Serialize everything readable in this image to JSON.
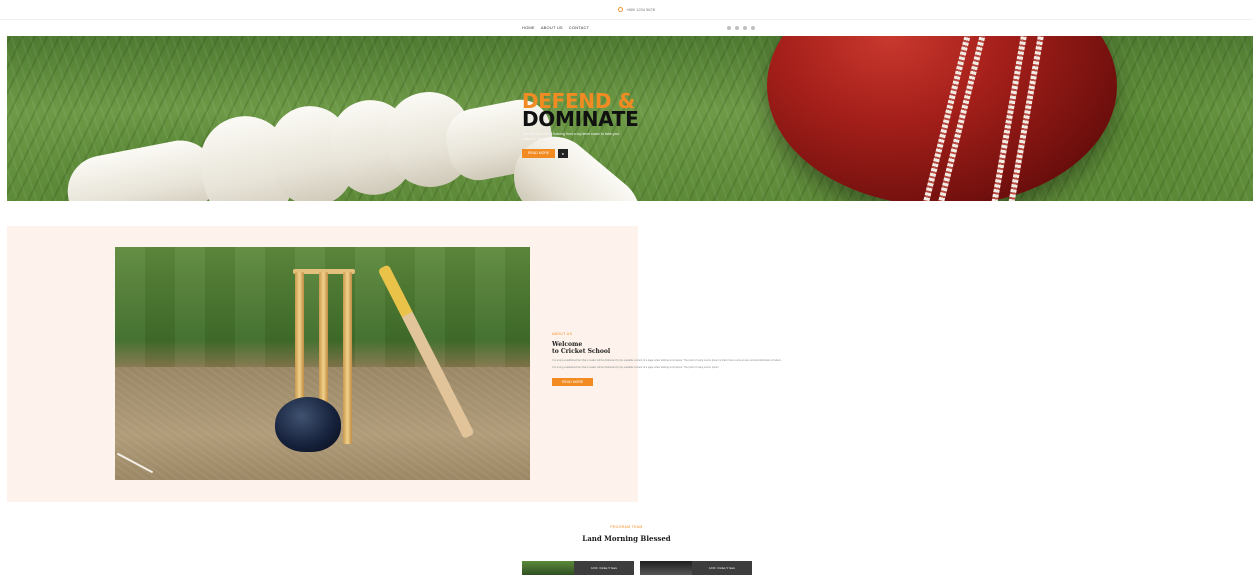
{
  "topbar": {
    "phone_icon": "phone-icon",
    "phone_text": "+880 1234 5678"
  },
  "nav": {
    "items": [
      "Home",
      "About Us",
      "Contact"
    ]
  },
  "socials": [
    "facebook-icon",
    "twitter-icon",
    "instagram-icon",
    "youtube-icon"
  ],
  "hero": {
    "title_accent": "DEFEND &",
    "title_main": "DOMINATE",
    "subtitle": "The ultimate cricket training from a top-level coach to take your cricket to the next level.",
    "cta_label": "Read More",
    "play_label": "▸"
  },
  "about": {
    "eyebrow": "About Us",
    "title_line1": "Welcome",
    "title_line2": "to Cricket School",
    "para1": "It is a long established fact that a reader will be distracted by the readable content of a page when looking at its layout. The point of using Lorem Ipsum is that it has a more-or-less normal distribution of letters.",
    "para2": "It is a long established fact that a reader will be distracted by the readable content of a page when looking at its layout. The point of using Lorem Ipsum.",
    "cta_label": "Read More"
  },
  "programs": {
    "eyebrow": "Program Team",
    "title": "Land Morning Blessed",
    "cards": [
      {
        "left_meta": "12:00",
        "right_meta": "Cricket, 5 Years"
      },
      {
        "left_meta": "12:00",
        "right_meta": "Cricket, 5 Years"
      }
    ]
  },
  "colors": {
    "accent": "#f28b22",
    "about_bg": "#fdf3ec",
    "dark": "#111111"
  }
}
